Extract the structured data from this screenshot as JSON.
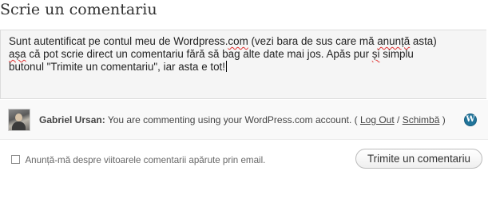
{
  "heading": "Scrie un comentariu",
  "comment": {
    "lines": [
      [
        "Sunt autentificat pe contul meu de Wordpress.",
        "com",
        " (vezi bara de sus care mă ",
        "anunță",
        " asta)"
      ],
      [
        "",
        "așa",
        " că pot scrie direct un comentariu fără să bag alte date mai jos. Apăs pur ",
        "și",
        " simplu"
      ],
      [
        "butonul \"Trimite un comentariu\", iar asta e tot!"
      ]
    ]
  },
  "identity": {
    "name": "Gabriel Ursan:",
    "message": " You are commenting using your WordPress.com account. ( ",
    "logout_label": "Log Out",
    "separator": " / ",
    "change_label": "Schimbă",
    "close_paren": " )",
    "service_icon": "wordpress-icon"
  },
  "notify": {
    "checked": false,
    "label": "Anunță-mă despre viitoarele comentarii apărute prin email."
  },
  "submit_label": "Trimite un comentariu"
}
